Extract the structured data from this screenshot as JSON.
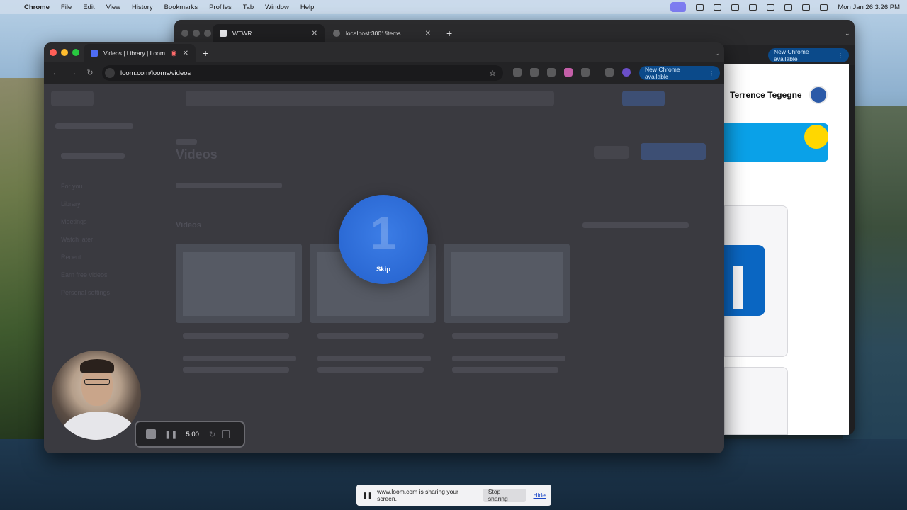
{
  "menubar": {
    "app": "Chrome",
    "items": [
      "File",
      "Edit",
      "View",
      "History",
      "Bookmarks",
      "Profiles",
      "Tab",
      "Window",
      "Help"
    ],
    "datetime": "Mon Jan 26  3:26 PM"
  },
  "back_window": {
    "tabs": [
      {
        "label": "WTWR"
      },
      {
        "label": "localhost:3001/items"
      }
    ],
    "new_chrome_label": "New Chrome available",
    "profile_name": "Terrence Tegegne"
  },
  "front_window": {
    "tab_label": "Videos | Library | Loom",
    "url": "loom.com/looms/videos",
    "new_chrome_label": "New Chrome available"
  },
  "loom": {
    "page_title": "Videos",
    "section_title": "Videos",
    "sidebar": [
      "For you",
      "Library",
      "Meetings",
      "Watch later",
      "Recent",
      "Earn free videos",
      "Personal settings"
    ]
  },
  "countdown": {
    "number": "1",
    "skip_label": "Skip"
  },
  "recorder": {
    "time": "5:00"
  },
  "sharing_bar": {
    "message": "www.loom.com is sharing your screen.",
    "stop_label": "Stop sharing",
    "hide_label": "Hide"
  },
  "colors": {
    "countdown_blue": "#2b69d4",
    "new_chrome_badge": "#0b4a8a",
    "close_red": "#ff5f57",
    "min_yellow": "#febc2e",
    "max_green": "#28c840"
  }
}
